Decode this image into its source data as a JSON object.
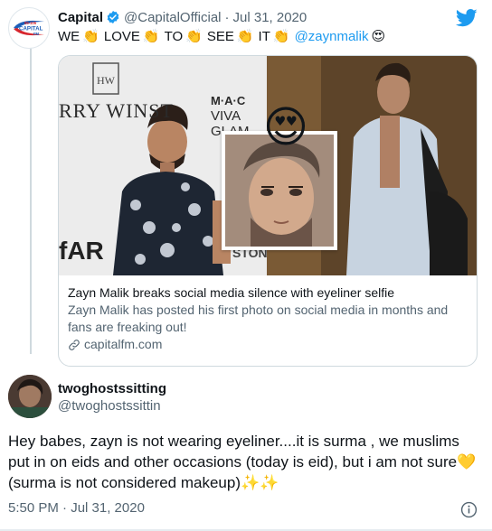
{
  "quoted_tweet": {
    "logo_text": {
      "top": "95-106",
      "mid": "CAPITAL",
      "bottom": "FM"
    },
    "author_name": "Capital",
    "author_handle": "@CapitalOfficial",
    "separator": "·",
    "date": "Jul 31, 2020",
    "text_parts": [
      "WE",
      "LOVE",
      "TO",
      "SEE",
      "IT"
    ],
    "mention": "@zaynmalik",
    "emoji_clap": "👏",
    "emoji_love": "😍",
    "card": {
      "image_text": {
        "sponsor_left": "RRY WINST",
        "sponsor_mac": "M·A·C",
        "sponsor_viva": "VIVA GLAM",
        "sponsor_far": "fAR",
        "sponsor_ston": "STON"
      },
      "title": "Zayn Malik breaks social media silence with eyeliner selfie",
      "description": "Zayn Malik has posted his first photo on social media in months and fans are freaking out!",
      "domain": "capitalfm.com"
    }
  },
  "reply_tweet": {
    "author_name": "twoghostssitting",
    "author_handle": "@twoghostssittin",
    "text": "Hey babes, zayn is not wearing eyeliner....it is surma , we muslims put in on eids and other occasions (today is eid), but i am not sure💛 (surma is not considered makeup)✨✨",
    "timestamp": "5:50 PM · Jul 31, 2020"
  },
  "colors": {
    "accent": "#1d9bf0",
    "secondary_text": "#536471",
    "border": "#cfd9de"
  },
  "icons": [
    "verified-badge-icon",
    "twitter-bird-icon",
    "link-icon",
    "info-icon"
  ]
}
